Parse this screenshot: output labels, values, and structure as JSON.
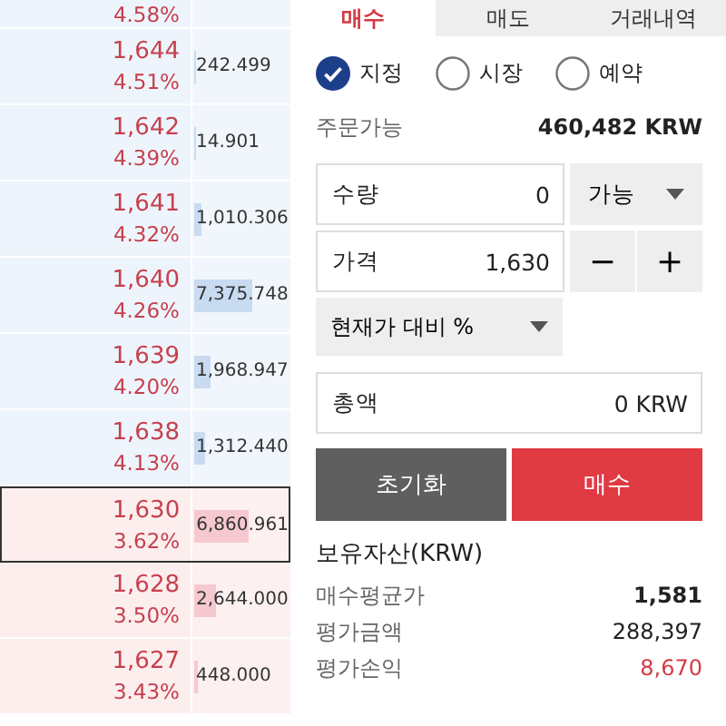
{
  "order_book": {
    "top_partial_change": "4.58%",
    "rows": [
      {
        "kind": "ask",
        "price": "1,644",
        "change": "4.51%",
        "volume": "242.499",
        "level": 0.02,
        "selected": false
      },
      {
        "kind": "ask",
        "price": "1,642",
        "change": "4.39%",
        "volume": "14.901",
        "level": 0.0,
        "selected": false
      },
      {
        "kind": "ask",
        "price": "1,641",
        "change": "4.32%",
        "volume": "1,010.306",
        "level": 0.08,
        "selected": false
      },
      {
        "kind": "ask",
        "price": "1,640",
        "change": "4.26%",
        "volume": "7,375.748",
        "level": 0.6,
        "selected": false
      },
      {
        "kind": "ask",
        "price": "1,639",
        "change": "4.20%",
        "volume": "1,968.947",
        "level": 0.16,
        "selected": false
      },
      {
        "kind": "ask",
        "price": "1,638",
        "change": "4.13%",
        "volume": "1,312.440",
        "level": 0.11,
        "selected": false
      },
      {
        "kind": "bid",
        "price": "1,630",
        "change": "3.62%",
        "volume": "6,860.961",
        "level": 0.56,
        "selected": true
      },
      {
        "kind": "bid",
        "price": "1,628",
        "change": "3.50%",
        "volume": "2,644.000",
        "level": 0.22,
        "selected": false
      },
      {
        "kind": "bid",
        "price": "1,627",
        "change": "3.43%",
        "volume": "448.000",
        "level": 0.04,
        "selected": false
      }
    ]
  },
  "tabs": [
    {
      "label": "매수",
      "selected": true
    },
    {
      "label": "매도",
      "selected": false
    },
    {
      "label": "거래내역",
      "selected": false
    }
  ],
  "order_types": [
    {
      "label": "지정",
      "selected": true
    },
    {
      "label": "시장",
      "selected": false
    },
    {
      "label": "예약",
      "selected": false
    }
  ],
  "available": {
    "label": "주문가능",
    "value": "460,482 KRW"
  },
  "quantity": {
    "label": "수량",
    "value": "0",
    "dropdown": "가능"
  },
  "price": {
    "label": "가격",
    "value": "1,630",
    "minus": "−",
    "plus": "+"
  },
  "percent_dropdown": "현재가 대비 %",
  "total": {
    "label": "총액",
    "value": "0 KRW"
  },
  "buttons": {
    "reset": "초기화",
    "submit": "매수"
  },
  "holdings": {
    "title": "보유자산(KRW)",
    "rows": [
      {
        "label": "매수평균가",
        "value": "1,581",
        "kind": "bold"
      },
      {
        "label": "평가금액",
        "value": "288,397",
        "kind": "plain"
      },
      {
        "label": "평가손익",
        "value": "8,670",
        "kind": "gain"
      }
    ]
  }
}
